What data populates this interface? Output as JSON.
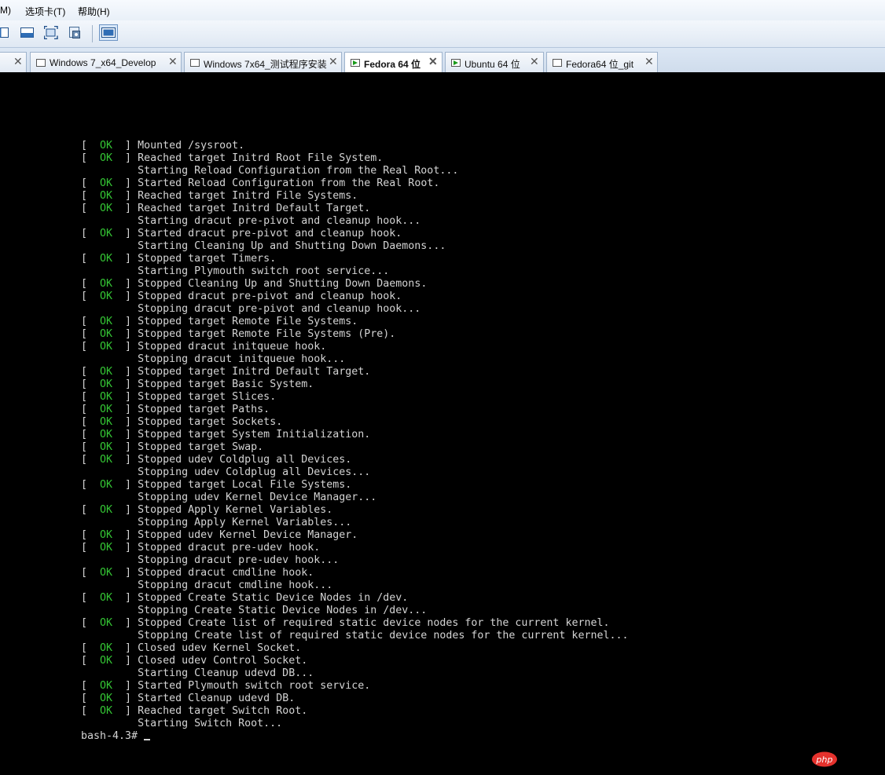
{
  "menubar": {
    "items": [
      "M)",
      "选项卡(T)",
      "帮助(H)"
    ]
  },
  "tabs": [
    {
      "label": "Windows 7_x64_Develop",
      "active": false
    },
    {
      "label": "Windows 7x64_测试程序安装",
      "active": false
    },
    {
      "label": "Fedora 64 位",
      "active": true
    },
    {
      "label": "Ubuntu 64 位",
      "active": false
    },
    {
      "label": "Fedora64 位_git",
      "active": false
    }
  ],
  "tab_close_glyph": "✕",
  "console": {
    "ok_label": "OK",
    "lines": [
      {
        "ok": true,
        "text": "Mounted /sysroot."
      },
      {
        "ok": true,
        "text": "Reached target Initrd Root File System."
      },
      {
        "ok": false,
        "text": "Starting Reload Configuration from the Real Root..."
      },
      {
        "ok": true,
        "text": "Started Reload Configuration from the Real Root."
      },
      {
        "ok": true,
        "text": "Reached target Initrd File Systems."
      },
      {
        "ok": true,
        "text": "Reached target Initrd Default Target."
      },
      {
        "ok": false,
        "text": "Starting dracut pre-pivot and cleanup hook..."
      },
      {
        "ok": true,
        "text": "Started dracut pre-pivot and cleanup hook."
      },
      {
        "ok": false,
        "text": "Starting Cleaning Up and Shutting Down Daemons..."
      },
      {
        "ok": true,
        "text": "Stopped target Timers."
      },
      {
        "ok": false,
        "text": "Starting Plymouth switch root service..."
      },
      {
        "ok": true,
        "text": "Stopped Cleaning Up and Shutting Down Daemons."
      },
      {
        "ok": true,
        "text": "Stopped dracut pre-pivot and cleanup hook."
      },
      {
        "ok": false,
        "text": "Stopping dracut pre-pivot and cleanup hook..."
      },
      {
        "ok": true,
        "text": "Stopped target Remote File Systems."
      },
      {
        "ok": true,
        "text": "Stopped target Remote File Systems (Pre)."
      },
      {
        "ok": true,
        "text": "Stopped dracut initqueue hook."
      },
      {
        "ok": false,
        "text": "Stopping dracut initqueue hook..."
      },
      {
        "ok": true,
        "text": "Stopped target Initrd Default Target."
      },
      {
        "ok": true,
        "text": "Stopped target Basic System."
      },
      {
        "ok": true,
        "text": "Stopped target Slices."
      },
      {
        "ok": true,
        "text": "Stopped target Paths."
      },
      {
        "ok": true,
        "text": "Stopped target Sockets."
      },
      {
        "ok": true,
        "text": "Stopped target System Initialization."
      },
      {
        "ok": true,
        "text": "Stopped target Swap."
      },
      {
        "ok": true,
        "text": "Stopped udev Coldplug all Devices."
      },
      {
        "ok": false,
        "text": "Stopping udev Coldplug all Devices..."
      },
      {
        "ok": true,
        "text": "Stopped target Local File Systems."
      },
      {
        "ok": false,
        "text": "Stopping udev Kernel Device Manager..."
      },
      {
        "ok": true,
        "text": "Stopped Apply Kernel Variables."
      },
      {
        "ok": false,
        "text": "Stopping Apply Kernel Variables..."
      },
      {
        "ok": true,
        "text": "Stopped udev Kernel Device Manager."
      },
      {
        "ok": true,
        "text": "Stopped dracut pre-udev hook."
      },
      {
        "ok": false,
        "text": "Stopping dracut pre-udev hook..."
      },
      {
        "ok": true,
        "text": "Stopped dracut cmdline hook."
      },
      {
        "ok": false,
        "text": "Stopping dracut cmdline hook..."
      },
      {
        "ok": true,
        "text": "Stopped Create Static Device Nodes in /dev."
      },
      {
        "ok": false,
        "text": "Stopping Create Static Device Nodes in /dev..."
      },
      {
        "ok": true,
        "text": "Stopped Create list of required static device nodes for the current kernel."
      },
      {
        "ok": false,
        "text": "Stopping Create list of required static device nodes for the current kernel..."
      },
      {
        "ok": true,
        "text": "Closed udev Kernel Socket."
      },
      {
        "ok": true,
        "text": "Closed udev Control Socket."
      },
      {
        "ok": false,
        "text": "Starting Cleanup udevd DB..."
      },
      {
        "ok": true,
        "text": "Started Plymouth switch root service."
      },
      {
        "ok": true,
        "text": "Started Cleanup udevd DB."
      },
      {
        "ok": true,
        "text": "Reached target Switch Root."
      },
      {
        "ok": false,
        "text": "Starting Switch Root..."
      }
    ],
    "prompt": "bash-4.3# "
  },
  "watermark": {
    "text": "php",
    "color": "#e5322d"
  },
  "colors": {
    "ok": "#34c534",
    "console_text": "#d4d4d4",
    "console_bg": "#000000"
  }
}
